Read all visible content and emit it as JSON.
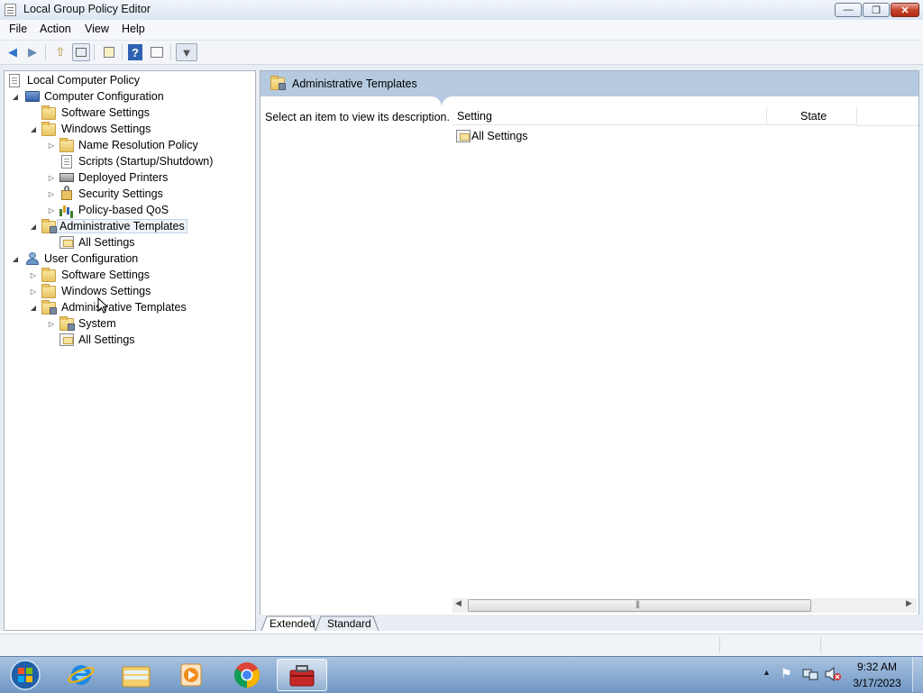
{
  "window": {
    "title": "Local Group Policy Editor",
    "minimize_symbol": "—",
    "maximize_symbol": "❐",
    "close_symbol": "✕"
  },
  "menu": [
    "File",
    "Action",
    "View",
    "Help"
  ],
  "toolbar": {
    "back_icon": "back-arrow-icon",
    "forward_icon": "forward-arrow-icon",
    "back_symbol": "◀",
    "forward_symbol": "▶",
    "up_symbol": "⇧",
    "help_symbol": "?",
    "filter_symbol": "▼"
  },
  "tree": {
    "root": "Local Computer Policy",
    "computer_configuration": "Computer Configuration",
    "cc_software_settings": "Software Settings",
    "cc_windows_settings": "Windows Settings",
    "name_resolution_policy": "Name Resolution Policy",
    "scripts": "Scripts (Startup/Shutdown)",
    "deployed_printers": "Deployed Printers",
    "security_settings": "Security Settings",
    "policy_qos": "Policy-based QoS",
    "cc_admin_templates": "Administrative Templates",
    "cc_all_settings": "All Settings",
    "user_configuration": "User Configuration",
    "uc_software_settings": "Software Settings",
    "uc_windows_settings": "Windows Settings",
    "uc_admin_templates": "Administrative Templates",
    "uc_system": "System",
    "uc_all_settings": "All Settings"
  },
  "details": {
    "header_title": "Administrative Templates",
    "description": "Select an item to view its description.",
    "columns": [
      "Setting",
      "State"
    ],
    "rows": [
      {
        "setting": "All Settings",
        "state": ""
      }
    ],
    "tabs": [
      "Extended",
      "Standard"
    ],
    "active_tab": "Extended"
  },
  "taskbar": {
    "apps": [
      "start-orb",
      "internet-explorer",
      "windows-explorer",
      "media-player",
      "chrome",
      "group-policy-toolbox"
    ],
    "time": "9:32 AM",
    "date": "3/17/2023"
  },
  "colors": {
    "header_band": "#b5c9df",
    "taskbar": "#6f96c4"
  }
}
